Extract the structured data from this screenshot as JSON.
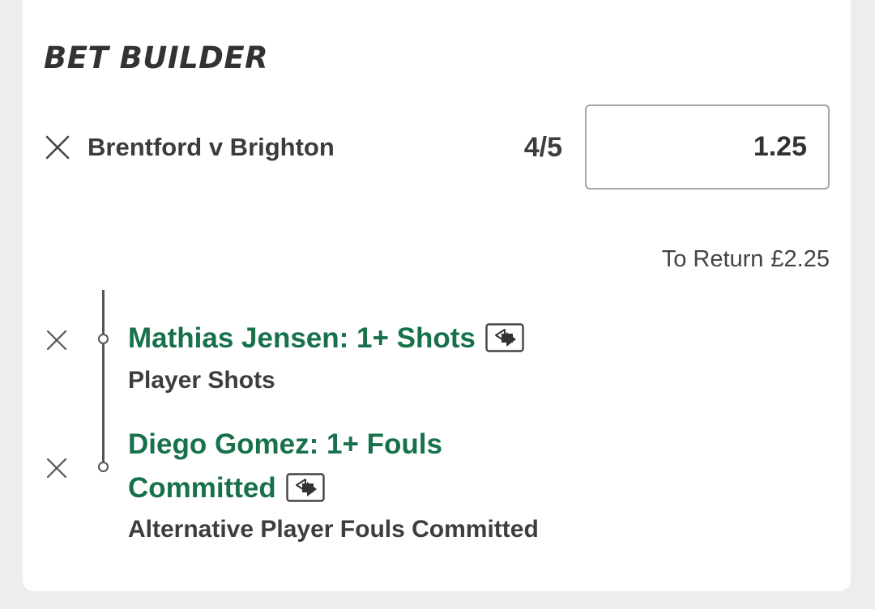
{
  "bet_builder": {
    "title": "BET BUILDER",
    "match": "Brentford v Brighton",
    "odds": "4/5",
    "stake_value": "1.25",
    "to_return_label": "To Return",
    "to_return_amount": "£2.25",
    "selections": [
      {
        "name": "Mathias Jensen: 1+ Shots",
        "market": "Player Shots"
      },
      {
        "name_line1": "Diego Gomez: 1+ Fouls",
        "name_line2": "Committed",
        "market": "Alternative Player Fouls Committed"
      }
    ]
  },
  "icons": {
    "remove": "close-icon",
    "swap": "swap-icon"
  },
  "colors": {
    "background": "#ededed",
    "card": "#ffffff",
    "selection_text": "#17714b",
    "body_text": "#3c3c3c"
  }
}
